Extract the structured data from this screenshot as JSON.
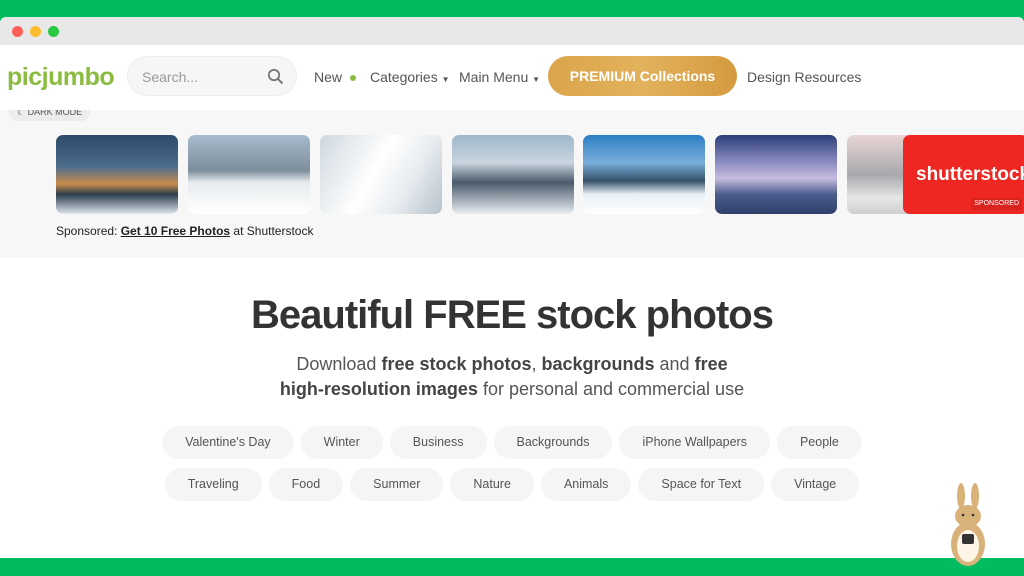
{
  "header": {
    "logo": "picjumbo",
    "search_placeholder": "Search...",
    "nav": {
      "new": "New",
      "categories": "Categories",
      "main_menu": "Main Menu",
      "premium": "PREMIUM Collections",
      "design": "Design Resources"
    },
    "dark_mode": "DARK MODE"
  },
  "sponsored": {
    "prefix": "Sponsored: ",
    "link": "Get 10 Free Photos",
    "suffix": " at Shutterstock",
    "brand": "shutterstock",
    "badge": "SPONSORED"
  },
  "hero": {
    "title": "Beautiful FREE stock photos",
    "sub1": "Download ",
    "b1": "free stock photos",
    "sub2": ", ",
    "b2": "backgrounds",
    "sub3": " and ",
    "b3": "free high-resolution images",
    "sub4": " for personal and commercial use"
  },
  "tags_row1": [
    "Valentine's Day",
    "Winter",
    "Business",
    "Backgrounds",
    "iPhone Wallpapers",
    "People"
  ],
  "tags_row2": [
    "Traveling",
    "Food",
    "Summer",
    "Nature",
    "Animals",
    "Space for Text",
    "Vintage"
  ],
  "colors": {
    "brand": "#8bbb3f",
    "frame": "#00bb5f",
    "premium": "#dba54a",
    "shutterstock": "#ee2722"
  }
}
